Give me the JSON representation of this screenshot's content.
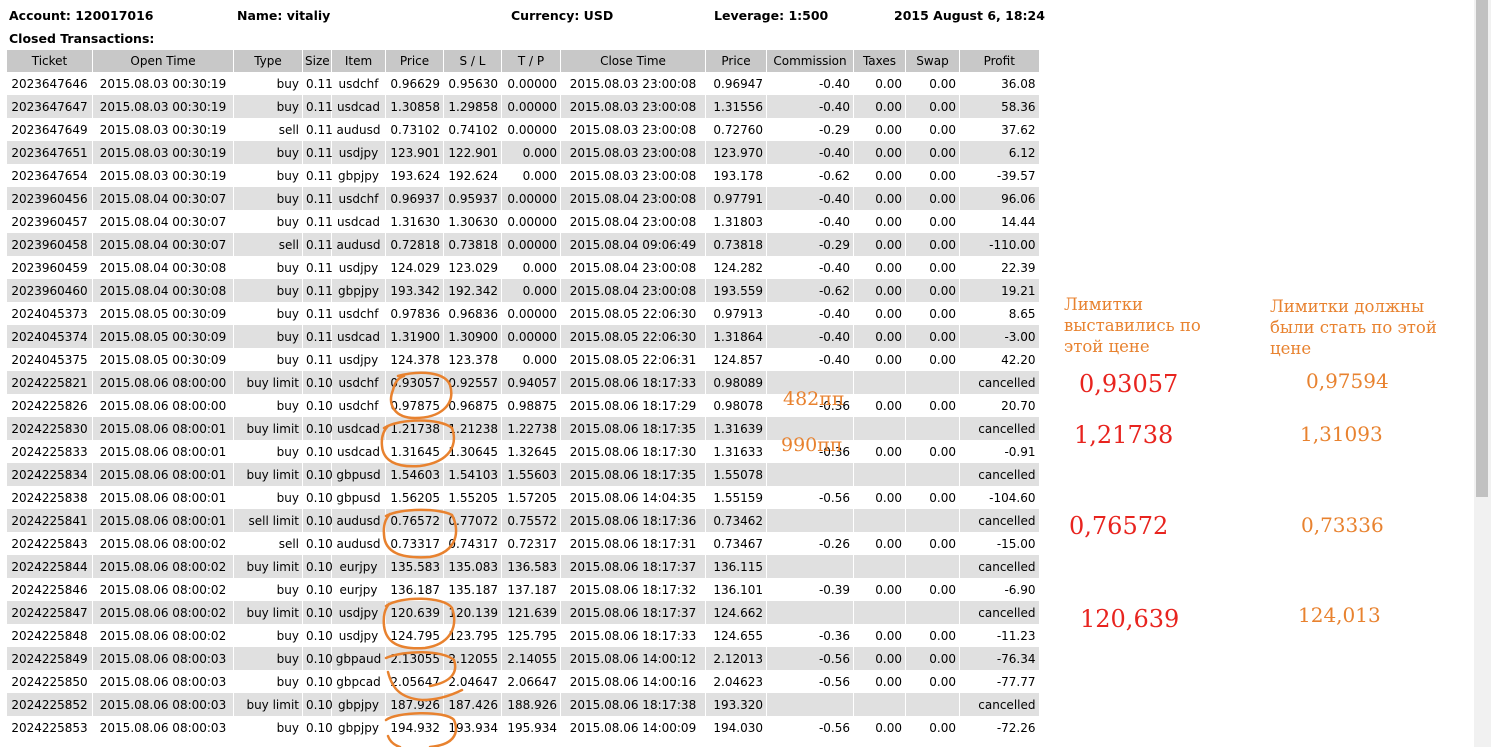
{
  "header": {
    "account": "Account: 120017016",
    "name": "Name: vitaliy",
    "currency": "Currency: USD",
    "leverage": "Leverage: 1:500",
    "datetime": "2015 August 6, 18:24"
  },
  "section_title": "Closed Transactions:",
  "columns": [
    "Ticket",
    "Open Time",
    "Type",
    "Size",
    "Item",
    "Price",
    "S / L",
    "T / P",
    "Close Time",
    "Price",
    "Commission",
    "Taxes",
    "Swap",
    "Profit"
  ],
  "rows": [
    [
      "2023647646",
      "2015.08.03 00:30:19",
      "buy",
      "0.11",
      "usdchf",
      "0.96629",
      "0.95630",
      "0.00000",
      "2015.08.03 23:00:08",
      "0.96947",
      "-0.40",
      "0.00",
      "0.00",
      "36.08"
    ],
    [
      "2023647647",
      "2015.08.03 00:30:19",
      "buy",
      "0.11",
      "usdcad",
      "1.30858",
      "1.29858",
      "0.00000",
      "2015.08.03 23:00:08",
      "1.31556",
      "-0.40",
      "0.00",
      "0.00",
      "58.36"
    ],
    [
      "2023647649",
      "2015.08.03 00:30:19",
      "sell",
      "0.11",
      "audusd",
      "0.73102",
      "0.74102",
      "0.00000",
      "2015.08.03 23:00:08",
      "0.72760",
      "-0.29",
      "0.00",
      "0.00",
      "37.62"
    ],
    [
      "2023647651",
      "2015.08.03 00:30:19",
      "buy",
      "0.11",
      "usdjpy",
      "123.901",
      "122.901",
      "0.000",
      "2015.08.03 23:00:08",
      "123.970",
      "-0.40",
      "0.00",
      "0.00",
      "6.12"
    ],
    [
      "2023647654",
      "2015.08.03 00:30:19",
      "buy",
      "0.11",
      "gbpjpy",
      "193.624",
      "192.624",
      "0.000",
      "2015.08.03 23:00:08",
      "193.178",
      "-0.62",
      "0.00",
      "0.00",
      "-39.57"
    ],
    [
      "2023960456",
      "2015.08.04 00:30:07",
      "buy",
      "0.11",
      "usdchf",
      "0.96937",
      "0.95937",
      "0.00000",
      "2015.08.04 23:00:08",
      "0.97791",
      "-0.40",
      "0.00",
      "0.00",
      "96.06"
    ],
    [
      "2023960457",
      "2015.08.04 00:30:07",
      "buy",
      "0.11",
      "usdcad",
      "1.31630",
      "1.30630",
      "0.00000",
      "2015.08.04 23:00:08",
      "1.31803",
      "-0.40",
      "0.00",
      "0.00",
      "14.44"
    ],
    [
      "2023960458",
      "2015.08.04 00:30:07",
      "sell",
      "0.11",
      "audusd",
      "0.72818",
      "0.73818",
      "0.00000",
      "2015.08.04 09:06:49",
      "0.73818",
      "-0.29",
      "0.00",
      "0.00",
      "-110.00"
    ],
    [
      "2023960459",
      "2015.08.04 00:30:08",
      "buy",
      "0.11",
      "usdjpy",
      "124.029",
      "123.029",
      "0.000",
      "2015.08.04 23:00:08",
      "124.282",
      "-0.40",
      "0.00",
      "0.00",
      "22.39"
    ],
    [
      "2023960460",
      "2015.08.04 00:30:08",
      "buy",
      "0.11",
      "gbpjpy",
      "193.342",
      "192.342",
      "0.000",
      "2015.08.04 23:00:08",
      "193.559",
      "-0.62",
      "0.00",
      "0.00",
      "19.21"
    ],
    [
      "2024045373",
      "2015.08.05 00:30:09",
      "buy",
      "0.11",
      "usdchf",
      "0.97836",
      "0.96836",
      "0.00000",
      "2015.08.05 22:06:30",
      "0.97913",
      "-0.40",
      "0.00",
      "0.00",
      "8.65"
    ],
    [
      "2024045374",
      "2015.08.05 00:30:09",
      "buy",
      "0.11",
      "usdcad",
      "1.31900",
      "1.30900",
      "0.00000",
      "2015.08.05 22:06:30",
      "1.31864",
      "-0.40",
      "0.00",
      "0.00",
      "-3.00"
    ],
    [
      "2024045375",
      "2015.08.05 00:30:09",
      "buy",
      "0.11",
      "usdjpy",
      "124.378",
      "123.378",
      "0.000",
      "2015.08.05 22:06:31",
      "124.857",
      "-0.40",
      "0.00",
      "0.00",
      "42.20"
    ],
    [
      "2024225821",
      "2015.08.06 08:00:00",
      "buy limit",
      "0.10",
      "usdchf",
      "0.93057",
      "0.92557",
      "0.94057",
      "2015.08.06 18:17:33",
      "0.98089",
      "",
      "",
      "",
      "cancelled"
    ],
    [
      "2024225826",
      "2015.08.06 08:00:00",
      "buy",
      "0.10",
      "usdchf",
      "0.97875",
      "0.96875",
      "0.98875",
      "2015.08.06 18:17:29",
      "0.98078",
      "-0.36",
      "0.00",
      "0.00",
      "20.70"
    ],
    [
      "2024225830",
      "2015.08.06 08:00:01",
      "buy limit",
      "0.10",
      "usdcad",
      "1.21738",
      "1.21238",
      "1.22738",
      "2015.08.06 18:17:35",
      "1.31639",
      "",
      "",
      "",
      "cancelled"
    ],
    [
      "2024225833",
      "2015.08.06 08:00:01",
      "buy",
      "0.10",
      "usdcad",
      "1.31645",
      "1.30645",
      "1.32645",
      "2015.08.06 18:17:30",
      "1.31633",
      "-0.36",
      "0.00",
      "0.00",
      "-0.91"
    ],
    [
      "2024225834",
      "2015.08.06 08:00:01",
      "buy limit",
      "0.10",
      "gbpusd",
      "1.54603",
      "1.54103",
      "1.55603",
      "2015.08.06 18:17:35",
      "1.55078",
      "",
      "",
      "",
      "cancelled"
    ],
    [
      "2024225838",
      "2015.08.06 08:00:01",
      "buy",
      "0.10",
      "gbpusd",
      "1.56205",
      "1.55205",
      "1.57205",
      "2015.08.06 14:04:35",
      "1.55159",
      "-0.56",
      "0.00",
      "0.00",
      "-104.60"
    ],
    [
      "2024225841",
      "2015.08.06 08:00:01",
      "sell limit",
      "0.10",
      "audusd",
      "0.76572",
      "0.77072",
      "0.75572",
      "2015.08.06 18:17:36",
      "0.73462",
      "",
      "",
      "",
      "cancelled"
    ],
    [
      "2024225843",
      "2015.08.06 08:00:02",
      "sell",
      "0.10",
      "audusd",
      "0.73317",
      "0.74317",
      "0.72317",
      "2015.08.06 18:17:31",
      "0.73467",
      "-0.26",
      "0.00",
      "0.00",
      "-15.00"
    ],
    [
      "2024225844",
      "2015.08.06 08:00:02",
      "buy limit",
      "0.10",
      "eurjpy",
      "135.583",
      "135.083",
      "136.583",
      "2015.08.06 18:17:37",
      "136.115",
      "",
      "",
      "",
      "cancelled"
    ],
    [
      "2024225846",
      "2015.08.06 08:00:02",
      "buy",
      "0.10",
      "eurjpy",
      "136.187",
      "135.187",
      "137.187",
      "2015.08.06 18:17:32",
      "136.101",
      "-0.39",
      "0.00",
      "0.00",
      "-6.90"
    ],
    [
      "2024225847",
      "2015.08.06 08:00:02",
      "buy limit",
      "0.10",
      "usdjpy",
      "120.639",
      "120.139",
      "121.639",
      "2015.08.06 18:17:37",
      "124.662",
      "",
      "",
      "",
      "cancelled"
    ],
    [
      "2024225848",
      "2015.08.06 08:00:02",
      "buy",
      "0.10",
      "usdjpy",
      "124.795",
      "123.795",
      "125.795",
      "2015.08.06 18:17:33",
      "124.655",
      "-0.36",
      "0.00",
      "0.00",
      "-11.23"
    ],
    [
      "2024225849",
      "2015.08.06 08:00:03",
      "buy",
      "0.10",
      "gbpaud",
      "2.13055",
      "2.12055",
      "2.14055",
      "2015.08.06 14:00:12",
      "2.12013",
      "-0.56",
      "0.00",
      "0.00",
      "-76.34"
    ],
    [
      "2024225850",
      "2015.08.06 08:00:03",
      "buy",
      "0.10",
      "gbpcad",
      "2.05647",
      "2.04647",
      "2.06647",
      "2015.08.06 14:00:16",
      "2.04623",
      "-0.56",
      "0.00",
      "0.00",
      "-77.77"
    ],
    [
      "2024225852",
      "2015.08.06 08:00:03",
      "buy limit",
      "0.10",
      "gbpjpy",
      "187.926",
      "187.426",
      "188.926",
      "2015.08.06 18:17:38",
      "193.320",
      "",
      "",
      "",
      "cancelled"
    ],
    [
      "2024225853",
      "2015.08.06 08:00:03",
      "buy",
      "0.10",
      "gbpjpy",
      "194.932",
      "193.934",
      "195.934",
      "2015.08.06 14:00:09",
      "194.030",
      "-0.56",
      "0.00",
      "0.00",
      "-72.26"
    ]
  ],
  "annotations": {
    "pips_1": "482пп",
    "pips_2": "990пп",
    "note_left": "Лимитки выставились по этой цене",
    "note_right": "Лимитки должны были стать по этой цене",
    "placed": [
      "0,93057",
      "1,21738",
      "0,76572",
      "120,639"
    ],
    "should": [
      "0,97594",
      "1,31093",
      "0,73336",
      "124,013"
    ]
  },
  "colors": {
    "header_bg": "#c8c8c8",
    "alt_row": "#e0e0e0",
    "annotation_orange": "#e8822f",
    "annotation_red": "#e8241f"
  }
}
